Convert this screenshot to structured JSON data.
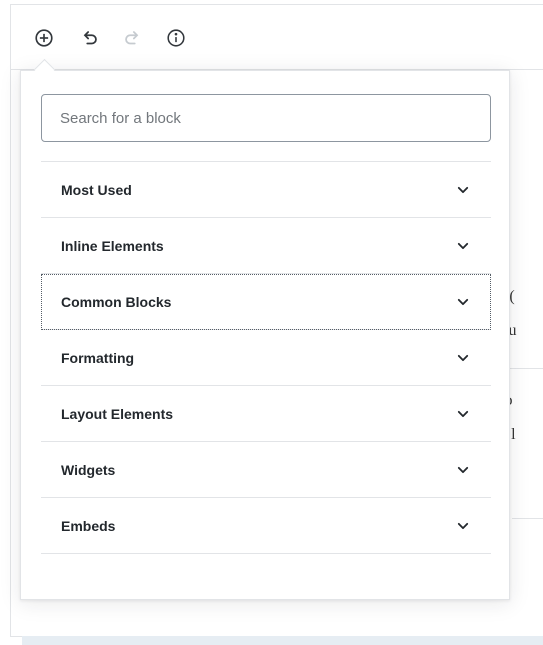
{
  "toolbar": {
    "icons": [
      "add-block-icon",
      "undo-icon",
      "redo-icon",
      "info-icon"
    ]
  },
  "inserter": {
    "search_placeholder": "Search for a block",
    "panels": [
      {
        "label": "Most Used",
        "icon": "chevron-down-icon"
      },
      {
        "label": "Inline Elements",
        "icon": "chevron-down-icon"
      },
      {
        "label": "Common Blocks",
        "icon": "chevron-down-icon",
        "focused": true
      },
      {
        "label": "Formatting",
        "icon": "chevron-down-icon"
      },
      {
        "label": "Layout Elements",
        "icon": "chevron-down-icon"
      },
      {
        "label": "Widgets",
        "icon": "chevron-down-icon"
      },
      {
        "label": "Embeds",
        "icon": "chevron-down-icon"
      }
    ]
  },
  "background_text": {
    "line1": "es (",
    "line2": "t ou",
    "line3": "dib",
    "line4": "ck l"
  },
  "colors": {
    "border": "#e2e4e7",
    "text": "#23282d",
    "search_border": "#8d96a0"
  }
}
